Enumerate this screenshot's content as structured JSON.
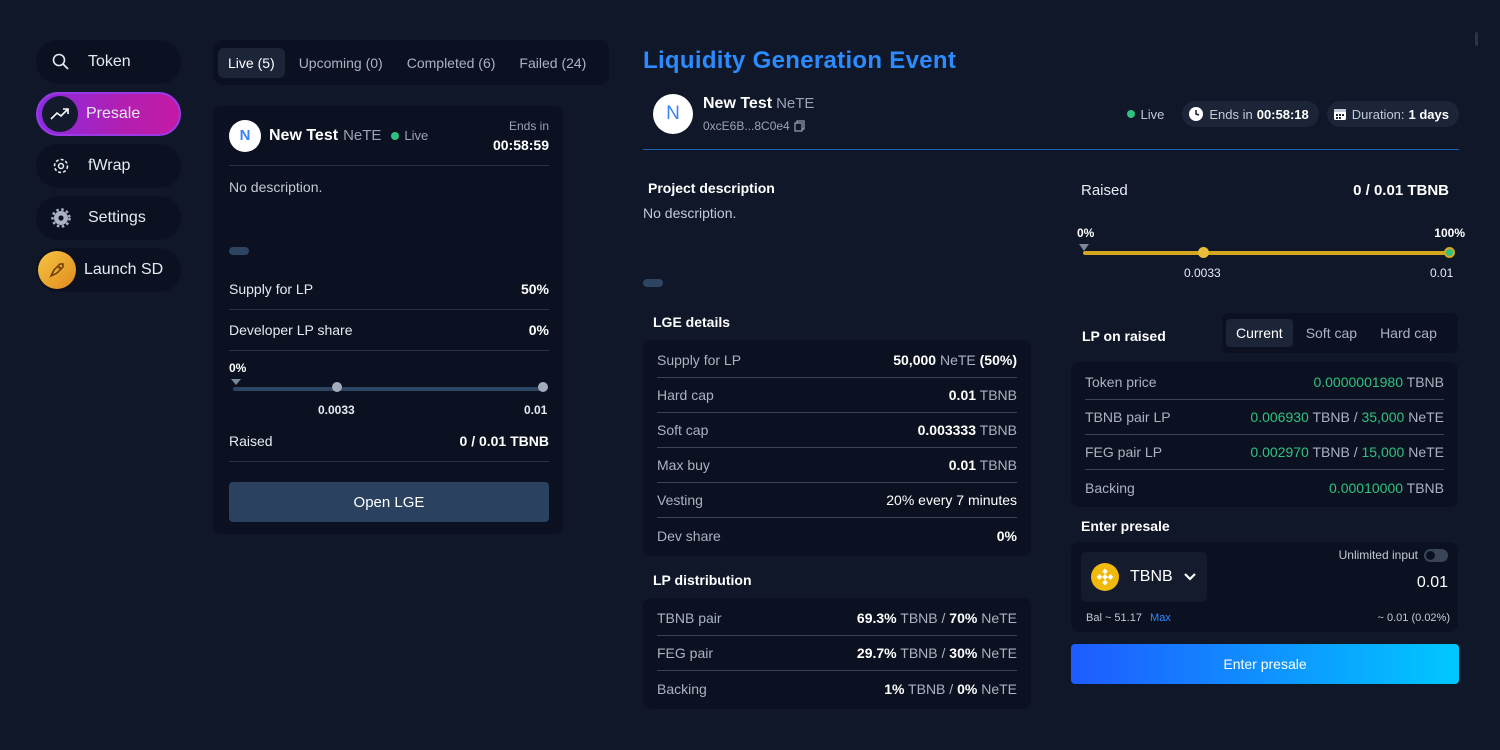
{
  "nav": {
    "items": [
      {
        "label": "Token",
        "icon": "search-icon"
      },
      {
        "label": "Presale",
        "icon": "trending-up-icon",
        "active": true
      },
      {
        "label": "fWrap",
        "icon": "cog-wheel-icon"
      },
      {
        "label": "Settings",
        "icon": "gear-icon"
      },
      {
        "label": "Launch SD",
        "icon": "rocket-icon"
      }
    ]
  },
  "tabs": [
    "Live (5)",
    "Upcoming (0)",
    "Completed (6)",
    "Failed (24)"
  ],
  "card": {
    "avatar": "N",
    "name": "New Test",
    "symbol": "NeTE",
    "status": "Live",
    "ends_label": "Ends in",
    "ends_value": "00:58:59",
    "description": "No description.",
    "rows": [
      {
        "k": "Supply for LP",
        "v": "50%"
      },
      {
        "k": "Developer LP share",
        "v": "0%"
      }
    ],
    "progress_pct": "0%",
    "soft_cap_label": "0.0033",
    "hard_cap_label": "0.01",
    "raised_label": "Raised",
    "raised_value": "0 / 0.01 TBNB",
    "button": "Open LGE"
  },
  "detail": {
    "title": "Liquidity Generation Event",
    "avatar": "N",
    "name": "New Test",
    "symbol": "NeTE",
    "address": "0xcE6B...8C0e4",
    "status": "Live",
    "ends_label": "Ends in",
    "ends_value": "00:58:18",
    "duration_label": "Duration:",
    "duration_value": "1 days",
    "project_desc_title": "Project description",
    "project_desc": "No description.",
    "lge_title": "LGE details",
    "lge_rows": [
      {
        "k": "Supply for LP",
        "v1": "50,000",
        "u1": " NeTE ",
        "v2": "(50%)"
      },
      {
        "k": "Hard cap",
        "v1": "0.01",
        "u1": " TBNB"
      },
      {
        "k": "Soft cap",
        "v1": "0.003333",
        "u1": " TBNB"
      },
      {
        "k": "Max buy",
        "v1": "0.01",
        "u1": " TBNB"
      },
      {
        "k": "Vesting",
        "v1": "20% every 7 minutes",
        "u1": ""
      },
      {
        "k": "Dev share",
        "v1": "0%",
        "u1": ""
      }
    ],
    "lp_dist_title": "LP distribution",
    "lp_dist_rows": [
      {
        "k": "TBNB pair",
        "a": "69.3%",
        "au": " TBNB / ",
        "b": "70%",
        "bu": " NeTE"
      },
      {
        "k": "FEG pair",
        "a": "29.7%",
        "au": " TBNB / ",
        "b": "30%",
        "bu": " NeTE"
      },
      {
        "k": "Backing",
        "a": "1%",
        "au": " TBNB / ",
        "b": "0%",
        "bu": " NeTE"
      }
    ],
    "raised_label": "Raised",
    "raised_value": "0 / 0.01 TBNB",
    "raised_progress_fraction": 0,
    "bar_start": "0%",
    "bar_end": "100%",
    "soft_cap_label": "0.0033",
    "hard_cap_label": "0.01",
    "lp_on_raised_title": "LP on raised",
    "lp_tabs": [
      "Current",
      "Soft cap",
      "Hard cap"
    ],
    "lp_rows": [
      {
        "k": "Token price",
        "g1": "0.0000001980",
        "u1": " TBNB"
      },
      {
        "k": "TBNB pair LP",
        "g1": "0.006930",
        "u1": " TBNB / ",
        "g2": "35,000",
        "u2": " NeTE"
      },
      {
        "k": "FEG pair LP",
        "g1": "0.002970",
        "u1": " TBNB / ",
        "g2": "15,000",
        "u2": " NeTE"
      },
      {
        "k": "Backing",
        "g1": "0.00010000",
        "u1": " TBNB"
      }
    ],
    "enter_title": "Enter presale",
    "unlimited_label": "Unlimited input",
    "token": "TBNB",
    "amount": "0.01",
    "balance": "Bal ~ 51.17",
    "max_label": "Max",
    "approx": "~ 0.01 (0.02%)",
    "enter_button": "Enter presale"
  },
  "colors": {
    "background": "#0f1729",
    "panel": "#0b1120",
    "accent_blue": "#2b8bff",
    "live_green": "#2ec27e",
    "progress_gold": "#d4a51e",
    "presale_gradient_start": "#8a2be2",
    "presale_gradient_end": "#c41aa6"
  }
}
